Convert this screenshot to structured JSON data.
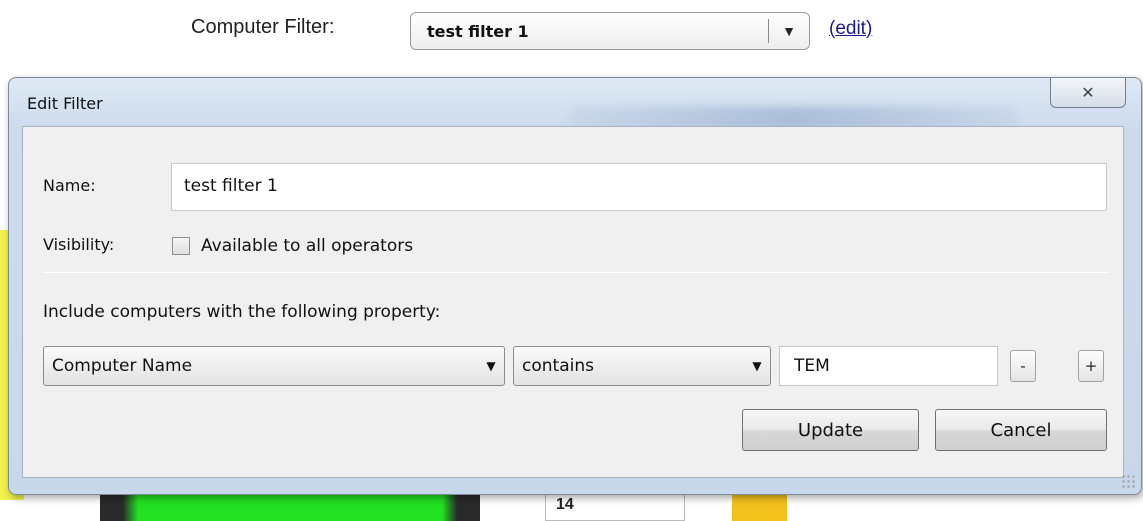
{
  "filter_bar": {
    "label": "Computer Filter:",
    "selected": "test filter 1",
    "arrow_icon": "▼",
    "edit_open": "(",
    "edit_label": "edit",
    "edit_close": ")"
  },
  "background": {
    "number": "14"
  },
  "dialog": {
    "title": "Edit Filter",
    "close_icon": "✕",
    "name_label": "Name:",
    "name_value": "test filter 1",
    "visibility_label": "Visibility:",
    "visibility_option": "Available to all operators",
    "visibility_checked": false,
    "property_heading": "Include computers with the following property:",
    "property_select": "Computer Name",
    "operator_select": "contains",
    "value_input": "TEM",
    "arrow_icon": "▼",
    "minus_label": "-",
    "plus_label": "+",
    "update_label": "Update",
    "cancel_label": "Cancel"
  }
}
